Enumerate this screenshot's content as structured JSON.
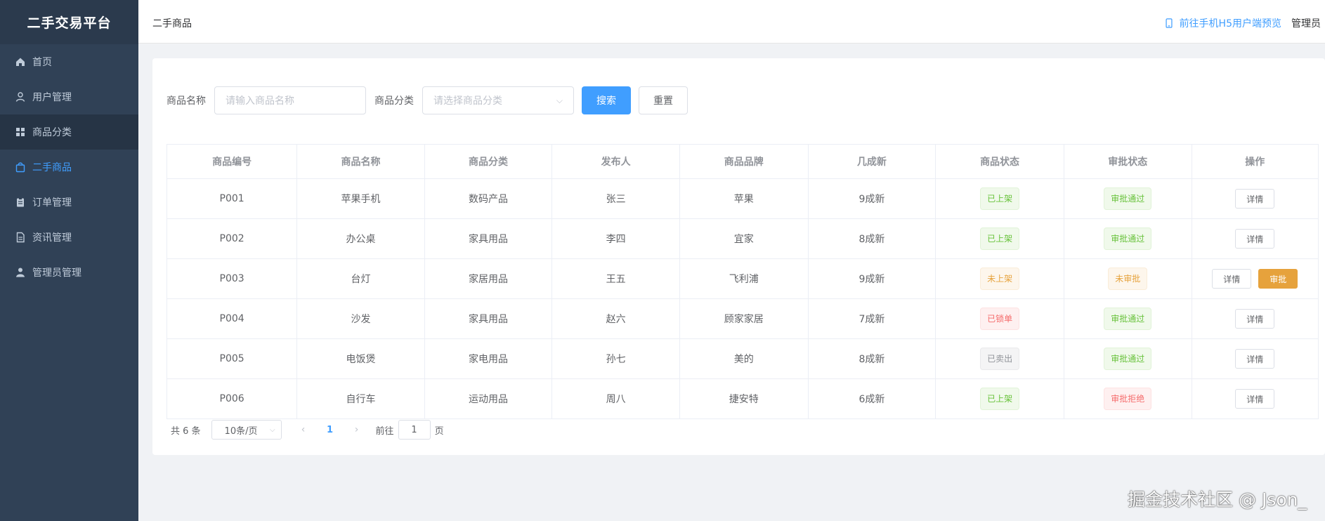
{
  "sidebar": {
    "brand": "二手交易平台",
    "items": [
      {
        "label": "首页",
        "icon": "home-icon"
      },
      {
        "label": "用户管理",
        "icon": "user-icon"
      },
      {
        "label": "商品分类",
        "icon": "grid-icon"
      },
      {
        "label": "二手商品",
        "icon": "bag-icon"
      },
      {
        "label": "订单管理",
        "icon": "clipboard-icon"
      },
      {
        "label": "资讯管理",
        "icon": "document-icon"
      },
      {
        "label": "管理员管理",
        "icon": "person-icon"
      }
    ],
    "active_index": 3,
    "hover_index": 2
  },
  "header": {
    "breadcrumb": "二手商品",
    "preview_link": "前往手机H5用户端预览",
    "user": "管理员"
  },
  "search": {
    "name_label": "商品名称",
    "name_placeholder": "请输入商品名称",
    "category_label": "商品分类",
    "category_placeholder": "请选择商品分类",
    "search_button": "搜索",
    "reset_button": "重置"
  },
  "table": {
    "columns": [
      "商品编号",
      "商品名称",
      "商品分类",
      "发布人",
      "商品品牌",
      "几成新",
      "商品状态",
      "审批状态",
      "操作"
    ],
    "rows": [
      {
        "id": "P001",
        "name": "苹果手机",
        "category": "数码产品",
        "publisher": "张三",
        "brand": "苹果",
        "condition": "9成新",
        "status": "已上架",
        "status_type": "success",
        "approval": "审批通过",
        "approval_type": "success",
        "detail": "详情",
        "approve": ""
      },
      {
        "id": "P002",
        "name": "办公桌",
        "category": "家具用品",
        "publisher": "李四",
        "brand": "宜家",
        "condition": "8成新",
        "status": "已上架",
        "status_type": "success",
        "approval": "审批通过",
        "approval_type": "success",
        "detail": "详情",
        "approve": ""
      },
      {
        "id": "P003",
        "name": "台灯",
        "category": "家居用品",
        "publisher": "王五",
        "brand": "飞利浦",
        "condition": "9成新",
        "status": "未上架",
        "status_type": "warning",
        "approval": "未审批",
        "approval_type": "warning",
        "detail": "详情",
        "approve": "审批"
      },
      {
        "id": "P004",
        "name": "沙发",
        "category": "家具用品",
        "publisher": "赵六",
        "brand": "顾家家居",
        "condition": "7成新",
        "status": "已锁单",
        "status_type": "danger",
        "approval": "审批通过",
        "approval_type": "success",
        "detail": "详情",
        "approve": ""
      },
      {
        "id": "P005",
        "name": "电饭煲",
        "category": "家电用品",
        "publisher": "孙七",
        "brand": "美的",
        "condition": "8成新",
        "status": "已卖出",
        "status_type": "info",
        "approval": "审批通过",
        "approval_type": "success",
        "detail": "详情",
        "approve": ""
      },
      {
        "id": "P006",
        "name": "自行车",
        "category": "运动用品",
        "publisher": "周八",
        "brand": "捷安特",
        "condition": "6成新",
        "status": "已上架",
        "status_type": "success",
        "approval": "审批拒绝",
        "approval_type": "danger",
        "detail": "详情",
        "approve": ""
      }
    ]
  },
  "pagination": {
    "total": "共 6 条",
    "page_size": "10条/页",
    "current_page": "1",
    "goto_label": "前往",
    "goto_value": "1",
    "page_suffix": "页"
  },
  "watermark": "掘金技术社区 @ Json_"
}
